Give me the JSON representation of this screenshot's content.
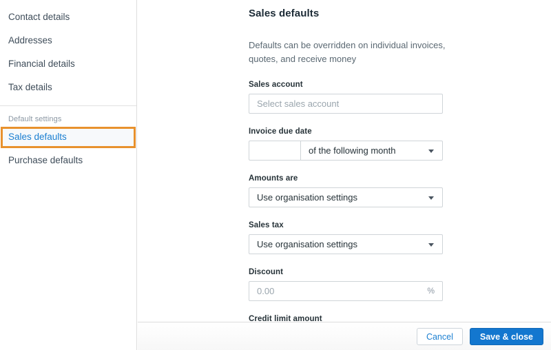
{
  "sidebar": {
    "primary_items": [
      {
        "label": "Contact details",
        "name": "sidebar-item-contact-details"
      },
      {
        "label": "Addresses",
        "name": "sidebar-item-addresses"
      },
      {
        "label": "Financial details",
        "name": "sidebar-item-financial-details"
      },
      {
        "label": "Tax details",
        "name": "sidebar-item-tax-details"
      }
    ],
    "section_label": "Default settings",
    "sales_defaults": "Sales defaults",
    "purchase_defaults": "Purchase defaults",
    "focus_ring_color": "#e8912d",
    "link_color": "#1b7fd1"
  },
  "main": {
    "title": "Sales defaults",
    "description": "Defaults can be overridden on individual invoices, quotes, and receive money",
    "fields": {
      "sales_account": {
        "label": "Sales account",
        "placeholder": "Select sales account",
        "value": ""
      },
      "invoice_due_date": {
        "label": "Invoice due date",
        "day_value": "",
        "day_placeholder": "",
        "term_value": "of the following month"
      },
      "amounts_are": {
        "label": "Amounts are",
        "value": "Use organisation settings"
      },
      "sales_tax": {
        "label": "Sales tax",
        "value": "Use organisation settings"
      },
      "discount": {
        "label": "Discount",
        "placeholder": "0.00",
        "value": "",
        "unit": "%"
      },
      "credit_limit_amount": {
        "label": "Credit limit amount",
        "value": "",
        "placeholder": ""
      }
    }
  },
  "footer": {
    "cancel_label": "Cancel",
    "save_label": "Save & close",
    "primary_color": "#1377cf"
  }
}
